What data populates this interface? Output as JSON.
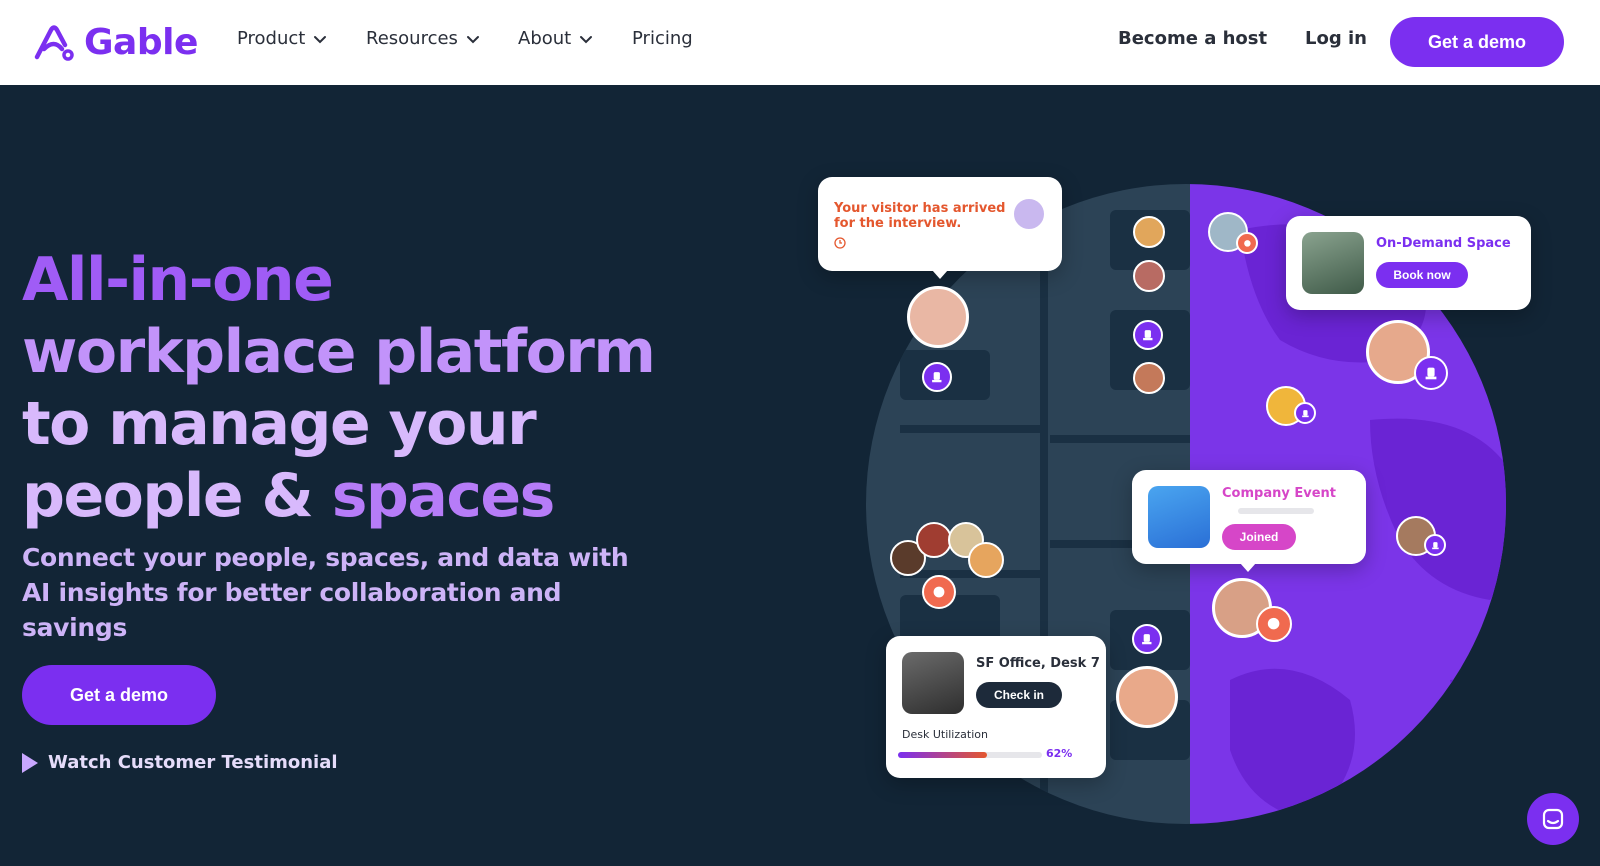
{
  "brand": {
    "name": "Gable",
    "color": "#7b2ff0"
  },
  "nav": {
    "items": [
      {
        "label": "Product",
        "has_dropdown": true
      },
      {
        "label": "Resources",
        "has_dropdown": true
      },
      {
        "label": "About",
        "has_dropdown": true
      },
      {
        "label": "Pricing",
        "has_dropdown": false
      }
    ],
    "become_host": "Become a host",
    "login": "Log in",
    "cta": "Get a demo"
  },
  "hero": {
    "title_lines": [
      "All-in-one",
      "workplace platform",
      "to manage your",
      "people &",
      "spaces"
    ],
    "subtitle": "Connect your people, spaces, and data with AI insights for better collaboration and savings",
    "cta": "Get a demo",
    "watch_label": "Watch Customer Testimonial"
  },
  "illustration": {
    "visitor_card": {
      "text": "Your visitor has arrived for the interview."
    },
    "on_demand_card": {
      "title": "On-Demand Space",
      "button": "Book now"
    },
    "event_card": {
      "title": "Company Event",
      "button": "Joined"
    },
    "desk_card": {
      "title": "SF Office, Desk 7",
      "button": "Check in",
      "metric_label": "Desk Utilization",
      "metric_value": "62%",
      "metric_fraction": 0.62
    }
  },
  "colors": {
    "background": "#122536",
    "accent": "#7b2ff0",
    "visitor_text": "#e4572e",
    "event_pink": "#d646c8",
    "badge_orange": "#f06a4f"
  }
}
